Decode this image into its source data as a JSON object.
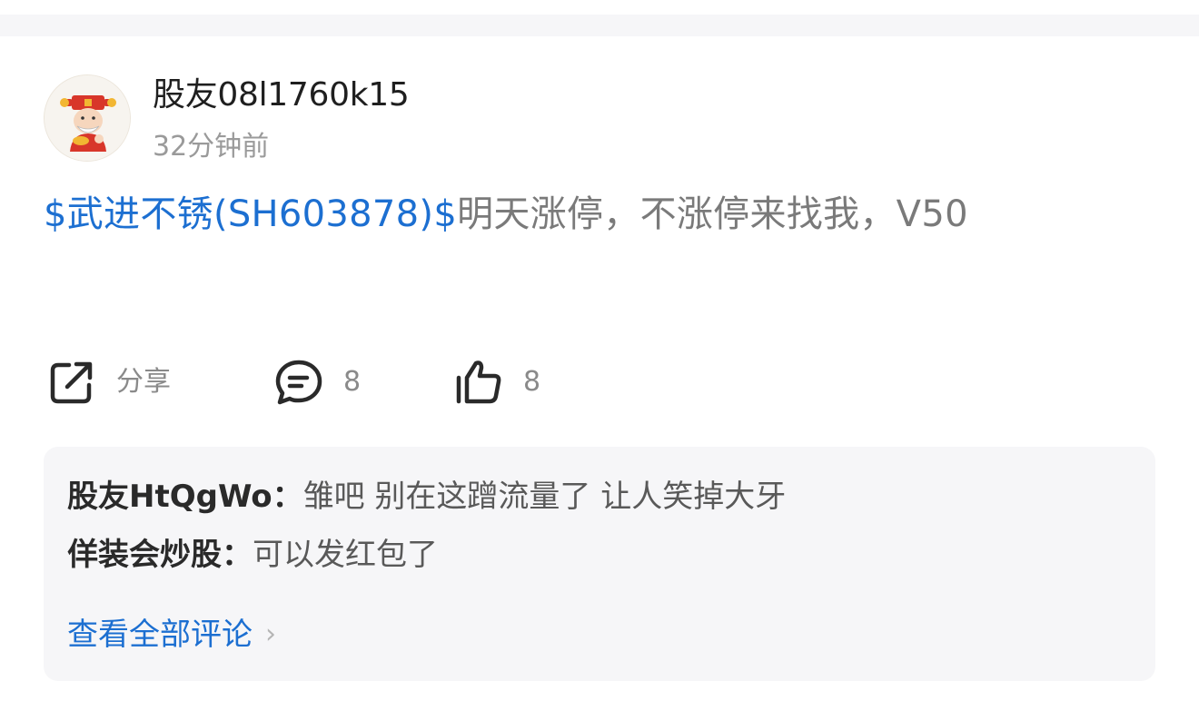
{
  "post": {
    "username": "股友08l1760k15",
    "time": "32分钟前",
    "stock_tag": "$武进不锈(SH603878)$",
    "text": "明天涨停，不涨停来找我，V50"
  },
  "actions": {
    "share_label": "分享",
    "comment_count": "8",
    "like_count": "8"
  },
  "comments": {
    "items": [
      {
        "user": "股友HtQgWo：",
        "text": "雏吧  别在这蹭流量了 让人笑掉大牙"
      },
      {
        "user": "佯装会炒股：",
        "text": "可以发红包了"
      }
    ],
    "view_all": "查看全部评论",
    "view_all_chevron": "›"
  },
  "icons": {
    "avatar": "caishen-avatar-icon",
    "share": "share-icon",
    "comment": "comment-icon",
    "like": "thumbs-up-icon"
  },
  "colors": {
    "link": "#1c6fd1",
    "text_muted": "#7a7a7a",
    "comment_bg": "#f6f6f8"
  }
}
